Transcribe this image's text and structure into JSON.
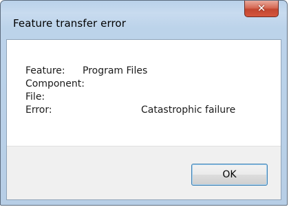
{
  "window": {
    "title": "Feature transfer error",
    "close_icon": "close-icon"
  },
  "details": {
    "feature_label": "Feature:",
    "feature_value": "Program Files",
    "component_label": "Component:",
    "component_value": "",
    "file_label": "File:",
    "file_value": "",
    "error_label": "Error:",
    "error_value": "Catastrophic failure"
  },
  "buttons": {
    "ok_label": "OK"
  },
  "colors": {
    "titlebar": "#bcd3ea",
    "close_button": "#c9503a",
    "footer": "#f0f0f0",
    "button_border": "#3c7fb1"
  }
}
